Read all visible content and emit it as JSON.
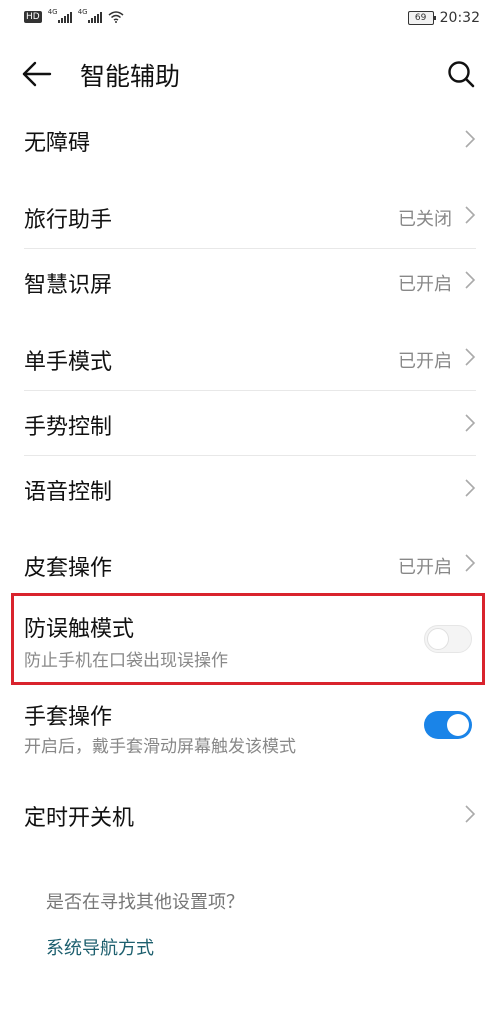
{
  "status_bar": {
    "hd": "HD",
    "net1": "4G",
    "net2": "4G",
    "battery": "69",
    "time": "20:32"
  },
  "header": {
    "title": "智能辅助",
    "back_icon": "arrow-left-icon",
    "search_icon": "search-icon"
  },
  "items": [
    {
      "label": "无障碍",
      "value": ""
    },
    {
      "label": "旅行助手",
      "value": "已关闭"
    },
    {
      "label": "智慧识屏",
      "value": "已开启"
    },
    {
      "label": "单手模式",
      "value": "已开启"
    },
    {
      "label": "手势控制",
      "value": ""
    },
    {
      "label": "语音控制",
      "value": ""
    },
    {
      "label": "皮套操作",
      "value": "已开启"
    }
  ],
  "anti_mistouch": {
    "label": "防误触模式",
    "subtitle": "防止手机在口袋出现误操作",
    "enabled": false
  },
  "glove": {
    "label": "手套操作",
    "subtitle": "开启后，戴手套滑动屏幕触发该模式",
    "enabled": true
  },
  "timer_power": {
    "label": "定时开关机"
  },
  "footer": {
    "question": "是否在寻找其他设置项？",
    "link": "系统导航方式"
  },
  "colors": {
    "accent": "#1a84e8",
    "highlight": "#d9232d",
    "link": "#1d5f6e"
  }
}
